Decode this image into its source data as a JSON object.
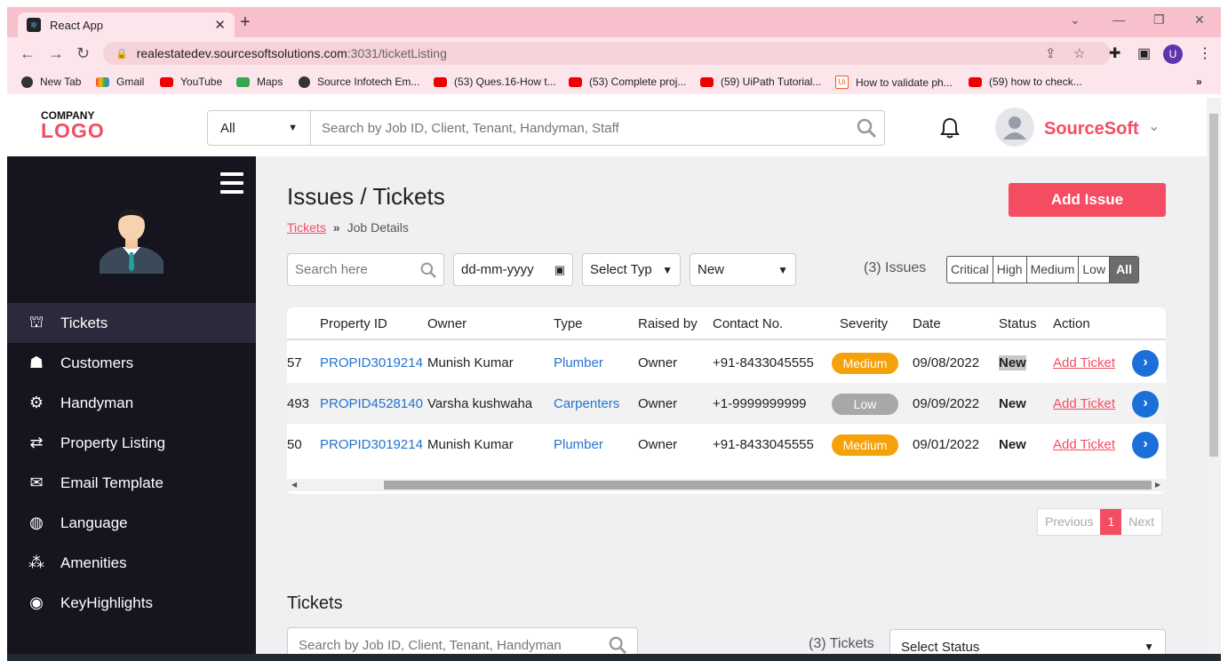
{
  "browser": {
    "tab_title": "React App",
    "url_host": "realestatedev.sourcesoftsolutions.com",
    "url_path": ":3031/ticketListing",
    "profile_initial": "U",
    "bookmarks": [
      {
        "label": "New Tab",
        "icon": "globe-icon"
      },
      {
        "label": "Gmail",
        "icon": "gmail-icon"
      },
      {
        "label": "YouTube",
        "icon": "youtube-icon"
      },
      {
        "label": "Maps",
        "icon": "maps-icon"
      },
      {
        "label": "Source Infotech Em...",
        "icon": "globe-icon"
      },
      {
        "label": "(53) Ques.16-How t...",
        "icon": "youtube-icon"
      },
      {
        "label": "(53) Complete proj...",
        "icon": "youtube-icon"
      },
      {
        "label": "(59) UiPath Tutorial...",
        "icon": "youtube-icon"
      },
      {
        "label": "How to validate ph...",
        "icon": "uipath-icon"
      },
      {
        "label": "(59) how to check...",
        "icon": "youtube-icon"
      }
    ],
    "more_bookmarks": "»"
  },
  "header": {
    "logo_top": "COMPANY",
    "logo_main": "LOGO",
    "search_category": "All",
    "search_placeholder": "Search by Job ID, Client, Tenant, Handyman, Staff",
    "user_name": "SourceSoft"
  },
  "sidebar": {
    "items": [
      {
        "label": "Tickets",
        "icon": "tickets-icon",
        "active": true
      },
      {
        "label": "Customers",
        "icon": "customers-icon"
      },
      {
        "label": "Handyman",
        "icon": "handyman-icon"
      },
      {
        "label": "Property Listing",
        "icon": "swap-arrows-icon"
      },
      {
        "label": "Email Template",
        "icon": "envelope-icon"
      },
      {
        "label": "Language",
        "icon": "globe-icon"
      },
      {
        "label": "Amenities",
        "icon": "amenities-icon"
      },
      {
        "label": "KeyHighlights",
        "icon": "key-highlights-icon"
      }
    ]
  },
  "main": {
    "title": "Issues / Tickets",
    "add_issue_label": "Add Issue",
    "breadcrumb": {
      "link": "Tickets",
      "sep": "»",
      "current": "Job Details"
    },
    "filters": {
      "search_placeholder": "Search here",
      "date_placeholder": "dd-mm-yyyy",
      "type_select": "Select Typ",
      "status_select": "New"
    },
    "issues_count": "(3) Issues",
    "severity_buttons": [
      "Critical",
      "High",
      "Medium",
      "Low",
      "All"
    ],
    "severity_active": "All",
    "table": {
      "columns": [
        "Property ID",
        "Owner",
        "Type",
        "Raised by",
        "Contact No.",
        "Severity",
        "Date",
        "Status",
        "Action"
      ],
      "rows": [
        {
          "id_frag": "57",
          "property_id": "PROPID3019214",
          "owner": "Munish Kumar",
          "type": "Plumber",
          "raised_by": "Owner",
          "contact": "+91-8433045555",
          "severity": "Medium",
          "date": "09/08/2022",
          "status": "New",
          "action": "Add Ticket"
        },
        {
          "id_frag": "493",
          "property_id": "PROPID4528140",
          "owner": "Varsha kushwaha",
          "type": "Carpenters",
          "raised_by": "Owner",
          "contact": "+1-9999999999",
          "severity": "Low",
          "date": "09/09/2022",
          "status": "New",
          "action": "Add Ticket"
        },
        {
          "id_frag": "50",
          "property_id": "PROPID3019214",
          "owner": "Munish Kumar",
          "type": "Plumber",
          "raised_by": "Owner",
          "contact": "+91-8433045555",
          "severity": "Medium",
          "date": "09/01/2022",
          "status": "New",
          "action": "Add Ticket"
        }
      ]
    },
    "pagination": {
      "prev": "Previous",
      "current": "1",
      "next": "Next"
    },
    "tickets_section": {
      "title": "Tickets",
      "search_placeholder": "Search by Job ID, Client, Tenant, Handyman",
      "count": "(3) Tickets",
      "status_select": "Select Status"
    }
  },
  "colors": {
    "accent": "#f44d62",
    "sidebar_bg": "#15141f",
    "link": "#2473d0",
    "medium": "#f5a10a",
    "low": "#a8a8a8"
  }
}
